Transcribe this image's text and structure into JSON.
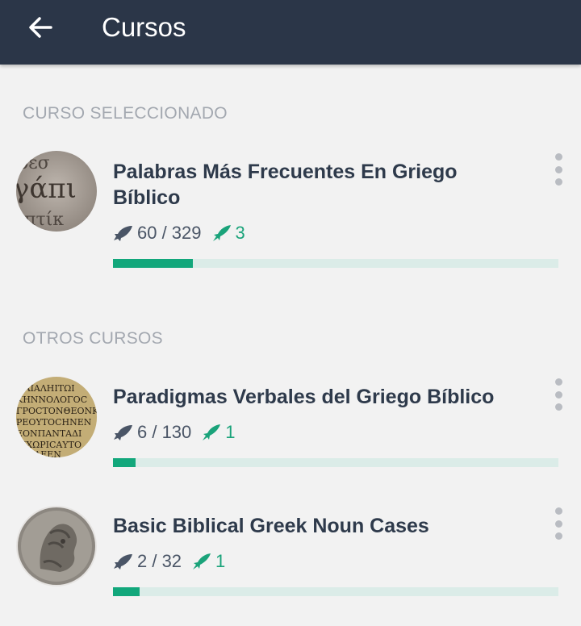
{
  "appbar": {
    "title": "Cursos",
    "back_icon": "arrow-left-icon"
  },
  "selected_section": {
    "header": "CURSO SELECCIONADO",
    "course": {
      "title_line1": "Palabras Más Frecuentes En Griego",
      "title_line2": "Bíblico",
      "learned": "60 / 329",
      "review": "3",
      "progress": 0.18,
      "thumbnail": "greek-inscription-stone"
    }
  },
  "other_section": {
    "header": "OTROS CURSOS",
    "courses": [
      {
        "title": "Paradigmas Verbales del Griego Bíblico",
        "learned": "6 / 130",
        "review": "1",
        "progress": 0.05,
        "thumbnail": "greek-manuscript"
      },
      {
        "title": "Basic Biblical Greek Noun Cases",
        "learned": "2 / 32",
        "review": "1",
        "progress": 0.06,
        "thumbnail": "ancient-coin"
      }
    ]
  },
  "colors": {
    "appbar": "#2b3648",
    "accent_green": "#12a77b",
    "progress_track": "#dbece8",
    "background": "#f2f2f2"
  }
}
